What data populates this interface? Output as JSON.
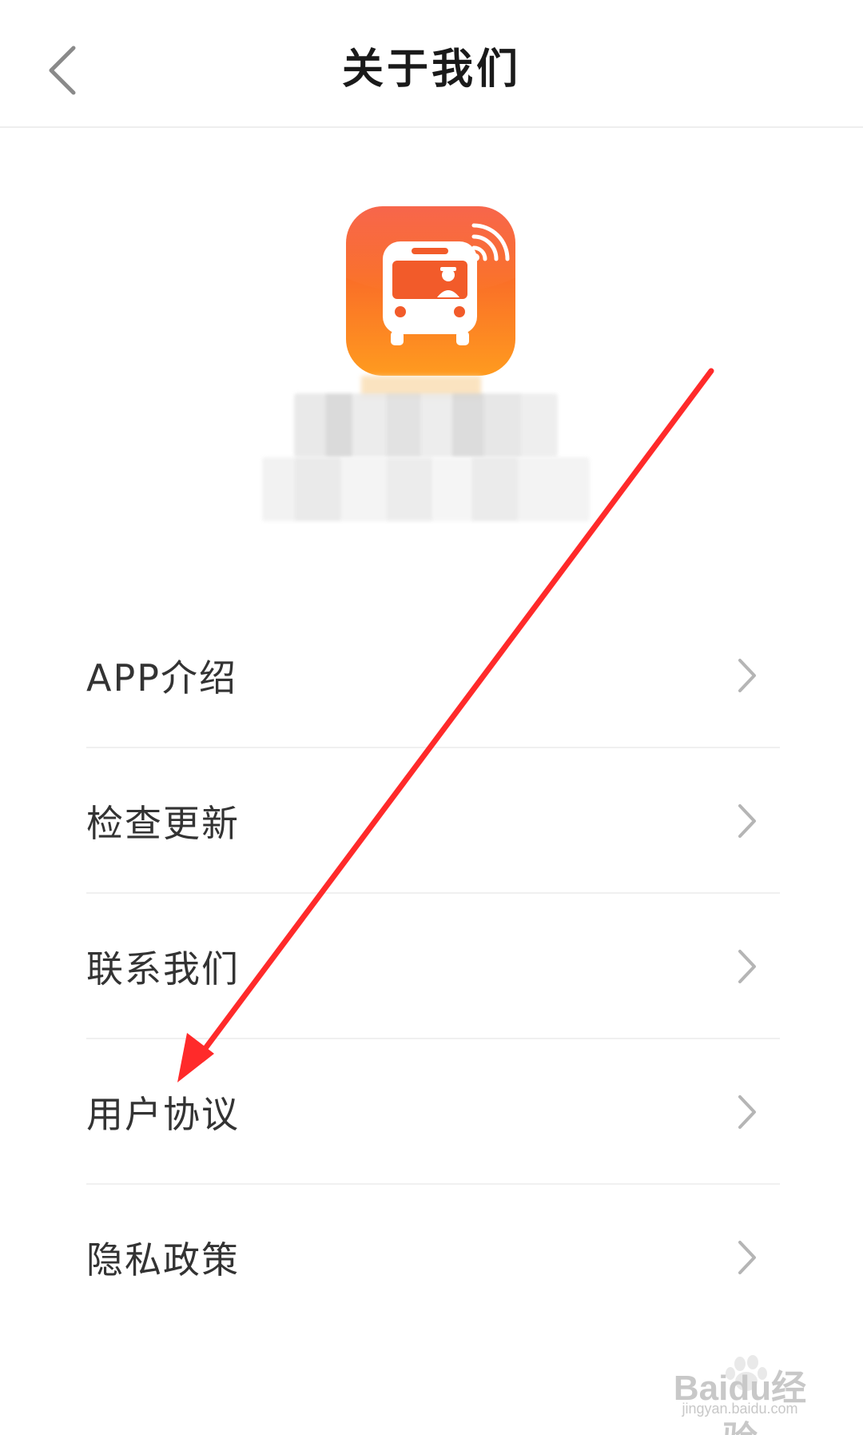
{
  "header": {
    "title": "关于我们"
  },
  "menu": {
    "items": [
      {
        "label": "APP介绍"
      },
      {
        "label": "检查更新"
      },
      {
        "label": "联系我们"
      },
      {
        "label": "用户协议"
      },
      {
        "label": "隐私政策"
      }
    ]
  },
  "icons": {
    "back": "chevron-left-icon",
    "item_chevron": "chevron-right-icon",
    "app_logo": "bus-logo-icon"
  },
  "colors": {
    "logo_top": "#f64d2e",
    "logo_bottom": "#ff9b1f",
    "annotation": "#ff2a2a",
    "title_text": "#1a1a1a",
    "item_text": "#333333",
    "chevron": "#b5b5b5"
  },
  "watermark": {
    "brand": "Baidu经验",
    "url": "jingyan.baidu.com"
  }
}
